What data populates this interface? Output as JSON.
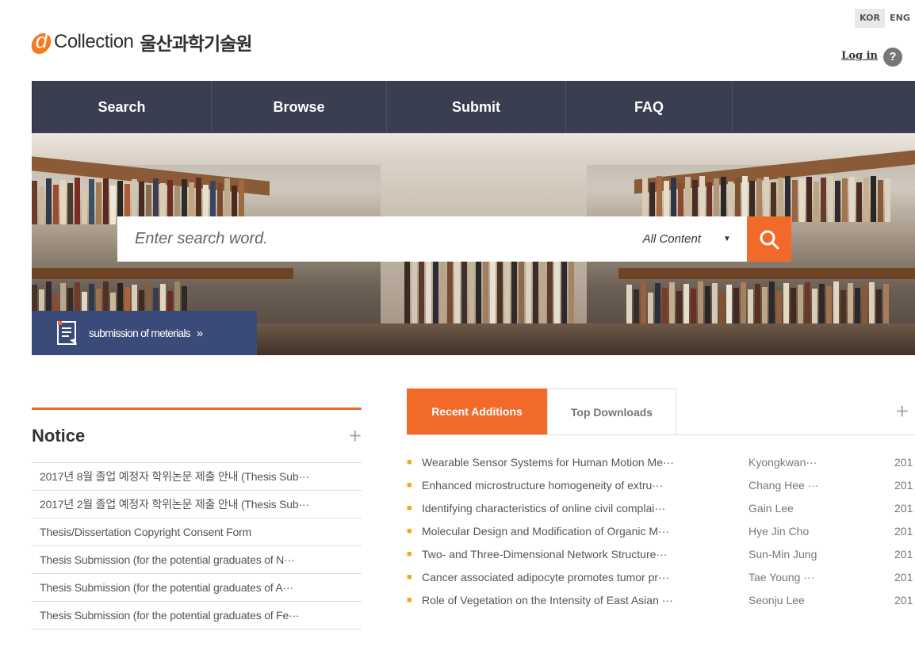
{
  "header": {
    "logo_text": "Collection",
    "logo_kor": "울산과학기술원",
    "lang_kor": "KOR",
    "lang_eng": "ENG",
    "login": "Log in",
    "help": "?"
  },
  "nav": [
    {
      "label": "Search"
    },
    {
      "label": "Browse"
    },
    {
      "label": "Submit"
    },
    {
      "label": "FAQ"
    },
    {
      "label": ""
    }
  ],
  "search": {
    "placeholder": "Enter search word.",
    "scope": "All Content"
  },
  "submission": {
    "label": "submission of meterials",
    "arrow": "»"
  },
  "notice": {
    "title": "Notice",
    "items": [
      "2017년 8월 졸업 예정자 학위논문 제출 안내 (Thesis Sub···",
      "2017년 2월 졸업 예정자 학위논문 제출 안내 (Thesis Sub···",
      "Thesis/Dissertation Copyright Consent Form",
      "Thesis Submission (for the potential graduates of N···",
      "Thesis Submission (for the potential graduates of A···",
      "Thesis Submission (for the potential graduates of Fe···"
    ]
  },
  "recent": {
    "tab_active": "Recent Additions",
    "tab_inactive": "Top Downloads",
    "items": [
      {
        "title": "Wearable Sensor Systems for Human Motion Me···",
        "author": "Kyongkwan···",
        "year": "201"
      },
      {
        "title": "Enhanced microstructure homogeneity of extru···",
        "author": "Chang Hee ···",
        "year": "201"
      },
      {
        "title": "Identifying characteristics of online civil complai···",
        "author": "Gain Lee",
        "year": "201"
      },
      {
        "title": "Molecular Design and Modification of Organic M···",
        "author": "Hye Jin Cho",
        "year": "201"
      },
      {
        "title": "Two- and Three-Dimensional Network Structure···",
        "author": "Sun-Min Jung",
        "year": "201"
      },
      {
        "title": "Cancer associated adipocyte promotes tumor pr···",
        "author": "Tae Young ···",
        "year": "201"
      },
      {
        "title": "Role of Vegetation on the Intensity of East Asian ···",
        "author": "Seonju Lee",
        "year": "201"
      }
    ]
  },
  "colors": {
    "accent": "#f26a2a",
    "nav_bg": "#3a3e51",
    "submission_bg": "#3a4b7a",
    "bullet": "#f5a623"
  },
  "icons": {
    "logo": "dcollection-logo-icon",
    "search": "search-icon",
    "help": "help-icon",
    "document": "document-icon",
    "plus": "plus-icon"
  }
}
